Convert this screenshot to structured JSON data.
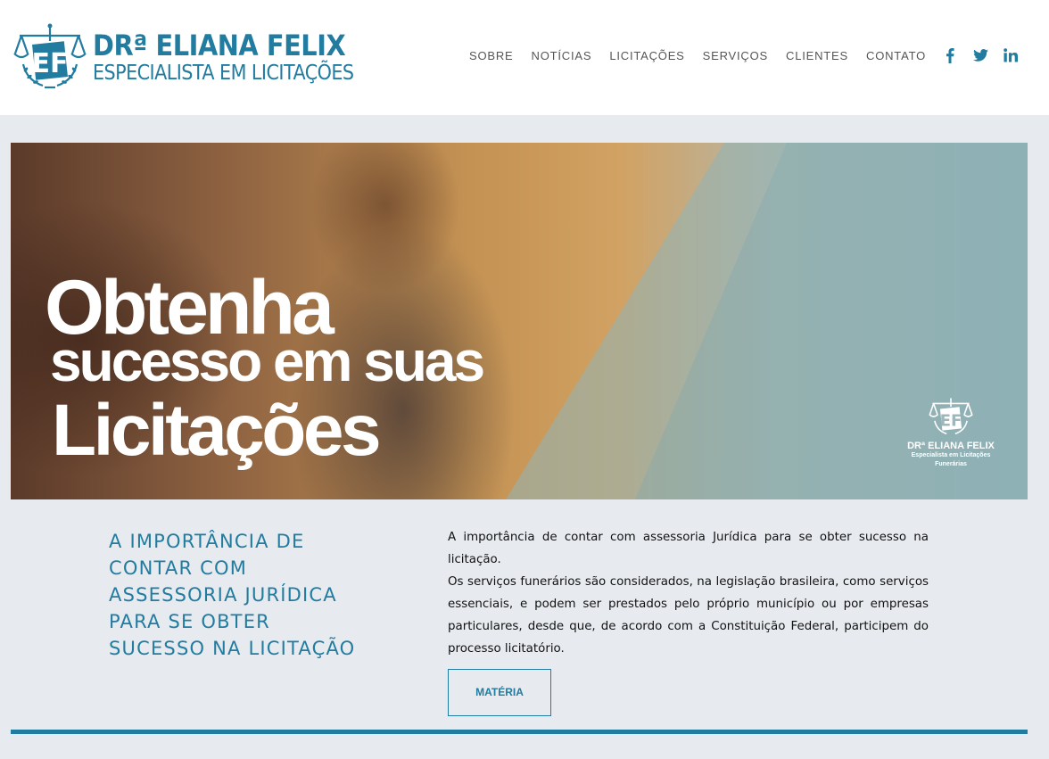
{
  "brand": {
    "name": "DRª ELIANA FELIX",
    "tagline": "ESPECIALISTA EM LICITAÇÕES",
    "monogram": "EF",
    "color": "#227ca0"
  },
  "nav": {
    "items": [
      {
        "label": "SOBRE"
      },
      {
        "label": "NOTÍCIAS"
      },
      {
        "label": "LICITAÇÕES"
      },
      {
        "label": "SERVIÇOS"
      },
      {
        "label": "CLIENTES"
      },
      {
        "label": "CONTATO"
      }
    ],
    "social": [
      {
        "icon": "facebook-icon"
      },
      {
        "icon": "twitter-icon"
      },
      {
        "icon": "linkedin-icon"
      }
    ]
  },
  "hero": {
    "line1": "Obtenha",
    "line2": "sucesso em suas",
    "line3": "Licitações",
    "logo_name": "DRª ELIANA FELIX",
    "logo_sub1": "Especialista em Licitações",
    "logo_sub2": "Funerárias"
  },
  "article": {
    "title": "A IMPORTÂNCIA DE CONTAR COM ASSESSORIA JURÍDICA PARA SE OBTER SUCESSO NA LICITAÇÃO",
    "paragraph1": "A importância de contar com assessoria Jurídica para se obter sucesso na licitação.",
    "paragraph2": "Os serviços funerários são considerados, na legislação brasileira, como serviços essenciais, e podem ser prestados pelo próprio município ou por empresas particulares, desde que, de acordo com a Constituição Federal, participem do processo licitatório.",
    "button_label": "MATÉRIA"
  }
}
